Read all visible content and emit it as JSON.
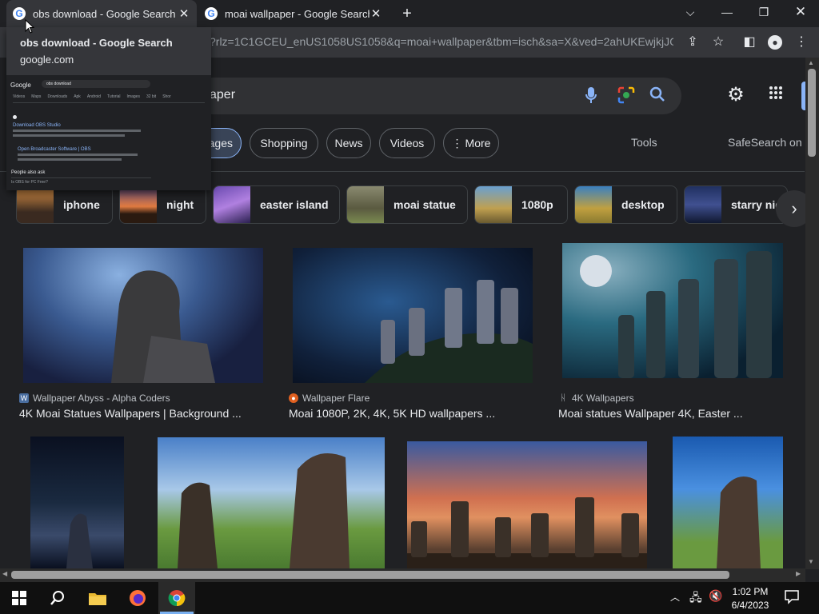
{
  "tabs": [
    {
      "title": "obs download - Google Search"
    },
    {
      "title": "moai wallpaper - Google Search"
    }
  ],
  "address": {
    "url": "?rlz=1C1GCEU_enUS1058US1058&q=moai+wallpaper&tbm=isch&sa=X&ved=2ahUKEwjkjJG..."
  },
  "search": {
    "query_tail": "aper"
  },
  "filters": [
    {
      "label": "ages"
    },
    {
      "label": "Shopping"
    },
    {
      "label": "News"
    },
    {
      "label": "Videos"
    },
    {
      "label": "More"
    }
  ],
  "tools": {
    "tools_label": "Tools",
    "safesearch_label": "SafeSearch on"
  },
  "related": [
    {
      "label": "iphone"
    },
    {
      "label": "night"
    },
    {
      "label": "easter island"
    },
    {
      "label": "moai statue"
    },
    {
      "label": "1080p"
    },
    {
      "label": "desktop"
    },
    {
      "label": "starry nig"
    }
  ],
  "results": [
    {
      "source": "Wallpaper Abyss - Alpha Coders",
      "caption": "4K Moai Statues Wallpapers | Background ..."
    },
    {
      "source": "Wallpaper Flare",
      "caption": "Moai 1080P, 2K, 4K, 5K HD wallpapers ..."
    },
    {
      "source": "4K Wallpapers",
      "caption": "Moai statues Wallpaper 4K, Easter ..."
    }
  ],
  "preview": {
    "title": "obs download - Google Search",
    "domain": "google.com",
    "logo": "Google",
    "query": "obs download",
    "nav": [
      "Videos",
      "Maps",
      "Downloads",
      "Apk",
      "Android",
      "Tutorial",
      "Images",
      "32 bit",
      "Shor"
    ],
    "link1": "Download OBS Studio",
    "link2": "Open Broadcaster Software | OBS",
    "paa": "People also ask",
    "question": "Is OBS for PC Free?"
  },
  "clock": {
    "time": "1:02 PM",
    "date": "6/4/2023"
  }
}
